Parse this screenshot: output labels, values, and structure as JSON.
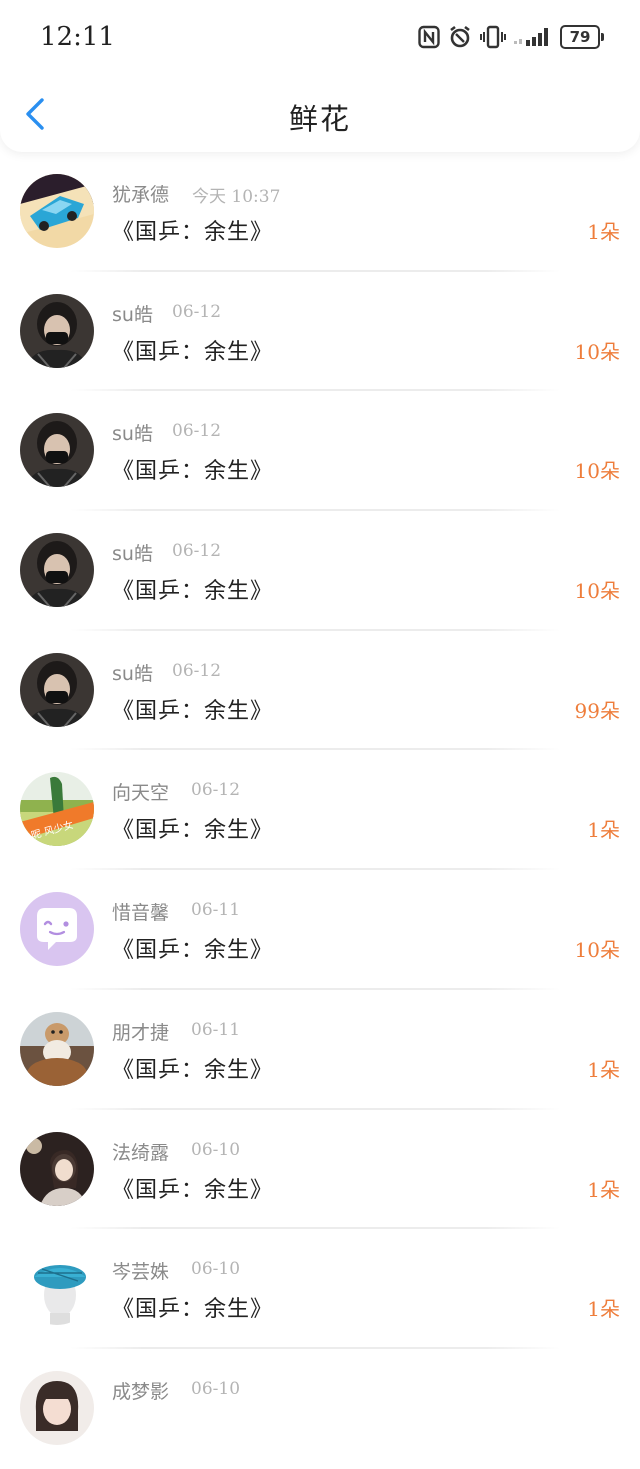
{
  "status_bar": {
    "time": "12:11",
    "battery": "79",
    "icons": [
      "nfc-icon",
      "alarm-icon",
      "vibrate-icon",
      "signal-icon",
      "battery-icon"
    ]
  },
  "nav": {
    "title": "鲜花",
    "back_icon": "chevron-left-icon"
  },
  "colors": {
    "accent_blue": "#2a8ff0",
    "count_orange": "#ee7d3b"
  },
  "items": [
    {
      "user": "犹承德",
      "date": "今天 10:37",
      "book": "《国乒：余生》",
      "count": "1朵",
      "avatar": "toy-car"
    },
    {
      "user": "su皓",
      "date": "06-12",
      "book": "《国乒：余生》",
      "count": "10朵",
      "avatar": "masked-person"
    },
    {
      "user": "su皓",
      "date": "06-12",
      "book": "《国乒：余生》",
      "count": "10朵",
      "avatar": "masked-person"
    },
    {
      "user": "su皓",
      "date": "06-12",
      "book": "《国乒：余生》",
      "count": "10朵",
      "avatar": "masked-person"
    },
    {
      "user": "su皓",
      "date": "06-12",
      "book": "《国乒：余生》",
      "count": "99朵",
      "avatar": "masked-person"
    },
    {
      "user": "向天空",
      "date": "06-12",
      "book": "《国乒：余生》",
      "count": "1朵",
      "avatar": "field-girl"
    },
    {
      "user": "惜音馨",
      "date": "06-11",
      "book": "《国乒：余生》",
      "count": "10朵",
      "avatar": "default-chat-bubble"
    },
    {
      "user": "朋才捷",
      "date": "06-11",
      "book": "《国乒：余生》",
      "count": "1朵",
      "avatar": "dog-photo"
    },
    {
      "user": "法绮露",
      "date": "06-10",
      "book": "《国乒：余生》",
      "count": "1朵",
      "avatar": "dark-portrait"
    },
    {
      "user": "岑芸姝",
      "date": "06-10",
      "book": "《国乒：余生》",
      "count": "1朵",
      "avatar": "blue-beret"
    },
    {
      "user": "成梦影",
      "date": "06-10",
      "book": "",
      "count": "",
      "avatar": "girl-portrait"
    }
  ]
}
